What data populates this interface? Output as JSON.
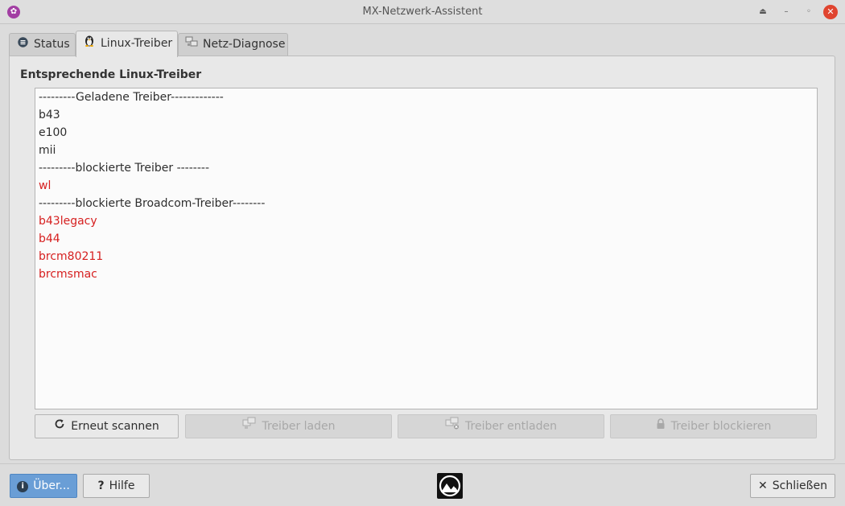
{
  "window": {
    "title": "MX-Netzwerk-Assistent",
    "accent_color": "#a23ea3",
    "close_color": "#e0442f"
  },
  "tabs": [
    {
      "label": "Status",
      "icon": "status-icon"
    },
    {
      "label": "Linux-Treiber",
      "icon": "tux-icon"
    },
    {
      "label": "Netz-Diagnose",
      "icon": "network-icon"
    }
  ],
  "active_tab": "Linux-Treiber",
  "section": {
    "title": "Entsprechende Linux-Treiber"
  },
  "driver_list": {
    "lines": [
      {
        "text": "---------Geladene Treiber-------------",
        "color": "#2e2e2e"
      },
      {
        "text": "b43",
        "color": "#2e2e2e"
      },
      {
        "text": "e100",
        "color": "#2e2e2e"
      },
      {
        "text": "mii",
        "color": "#2e2e2e"
      },
      {
        "text": "---------blockierte Treiber --------",
        "color": "#2e2e2e"
      },
      {
        "text": "wl",
        "color": "#d61f1f"
      },
      {
        "text": "---------blockierte Broadcom-Treiber--------",
        "color": "#2e2e2e"
      },
      {
        "text": "b43legacy",
        "color": "#d61f1f"
      },
      {
        "text": "b44",
        "color": "#d61f1f"
      },
      {
        "text": "brcm80211",
        "color": "#d61f1f"
      },
      {
        "text": "brcmsmac",
        "color": "#d61f1f"
      }
    ]
  },
  "actions": {
    "rescan_label": "Erneut scannen",
    "load_label": "Treiber laden",
    "unload_label": "Treiber entladen",
    "block_label": "Treiber blockieren"
  },
  "footer": {
    "about_label": "Über...",
    "help_label": "Hilfe",
    "close_label": "Schließen",
    "about_color": "#6a9ed6"
  }
}
